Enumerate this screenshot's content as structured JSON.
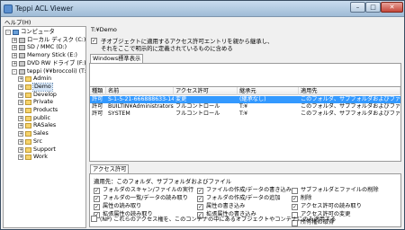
{
  "window": {
    "title": "Teppi ACL Viewer"
  },
  "menu": {
    "help": "ヘルプ(H)"
  },
  "tree": [
    {
      "label": "コンピュータ",
      "level": 0,
      "expander": "-",
      "icon": "computer-icon"
    },
    {
      "label": "ローカル ディスク (C:)",
      "level": 1,
      "expander": "+",
      "icon": "drive-icon"
    },
    {
      "label": "SD / MMC (D:)",
      "level": 1,
      "expander": "+",
      "icon": "drive-icon"
    },
    {
      "label": "Memory Stick (E:)",
      "level": 1,
      "expander": "+",
      "icon": "drive-icon"
    },
    {
      "label": "DVD RW ドライブ (F:)",
      "level": 1,
      "expander": "+",
      "icon": "drive-icon"
    },
    {
      "label": "teppi (¥¥broccoli) (T:)",
      "level": 1,
      "expander": "-",
      "icon": "drive-icon"
    },
    {
      "label": "Admin",
      "level": 2,
      "expander": "+",
      "icon": "folder-icon"
    },
    {
      "label": "Demo",
      "level": 2,
      "expander": "+",
      "icon": "folder-icon",
      "selected": true
    },
    {
      "label": "Develop",
      "level": 2,
      "expander": "+",
      "icon": "folder-icon"
    },
    {
      "label": "Private",
      "level": 2,
      "expander": "+",
      "icon": "folder-icon"
    },
    {
      "label": "Products",
      "level": 2,
      "expander": "+",
      "icon": "folder-icon"
    },
    {
      "label": "public",
      "level": 2,
      "expander": "+",
      "icon": "folder-icon"
    },
    {
      "label": "RASales",
      "level": 2,
      "expander": "+",
      "icon": "folder-icon"
    },
    {
      "label": "Sales",
      "level": 2,
      "expander": "+",
      "icon": "folder-icon"
    },
    {
      "label": "Src",
      "level": 2,
      "expander": "+",
      "icon": "folder-icon"
    },
    {
      "label": "Support",
      "level": 2,
      "expander": "+",
      "icon": "folder-icon"
    },
    {
      "label": "Work",
      "level": 2,
      "expander": "+",
      "icon": "folder-icon"
    }
  ],
  "path": "T:¥Demo",
  "inherit": {
    "checked": true,
    "line1": "子オブジェクトに適用するアクセス許可エントリを親から継承し、",
    "line2": "それをここで明示的に定義されているものに含める"
  },
  "tabs": {
    "windows_standard": "Windows標準表示",
    "access_perm": "アクセス許可"
  },
  "acl_list": {
    "columns": [
      "種類",
      "名前",
      "アクセス許可",
      "継承元",
      "適用先"
    ],
    "rows": [
      {
        "type": "許可",
        "name": "S-1-5-21-666888633-14",
        "perm": "変更",
        "inherit": "(継承なし)",
        "apply": "このフォルダ、サブフォルダおよびファイル"
      },
      {
        "type": "許可",
        "name": "BUILTIN¥Administrators",
        "perm": "フルコントロール",
        "inherit": "T:¥",
        "apply": "このフォルダ、サブフォルダおよびファイル"
      },
      {
        "type": "許可",
        "name": "SYSTEM",
        "perm": "フルコントロール",
        "inherit": "T:¥",
        "apply": "このフォルダ、サブフォルダおよびファイル"
      }
    ]
  },
  "access_panel": {
    "applies_to": "適用先：このフォルダ、サブフォルダおよびファイル",
    "permissions": [
      {
        "label": "フォルダのスキャン/ファイルの実行",
        "checked": true
      },
      {
        "label": "フォルダの一覧/データの読み取り",
        "checked": true
      },
      {
        "label": "属性の読み取り",
        "checked": true
      },
      {
        "label": "拡張属性の読み取り",
        "checked": true
      },
      {
        "label": "ファイルの作成/データの書き込み",
        "checked": true
      },
      {
        "label": "フォルダの作成/データの追加",
        "checked": true
      },
      {
        "label": "属性の書き込み",
        "checked": true
      },
      {
        "label": "拡張属性の書き込み",
        "checked": true
      },
      {
        "label": "サブフォルダとファイルの削除",
        "checked": false
      },
      {
        "label": "削除",
        "checked": true
      },
      {
        "label": "アクセス許可の読み取り",
        "checked": true
      },
      {
        "label": "アクセス許可の変更",
        "checked": false
      },
      {
        "label": "所有権の取得",
        "checked": false
      }
    ]
  },
  "bottom_option": {
    "checked": false,
    "label": "(NP) これらのアクセス権を、このコンテナの中にあるオブジェクトやコンテナにのみ適用する"
  }
}
